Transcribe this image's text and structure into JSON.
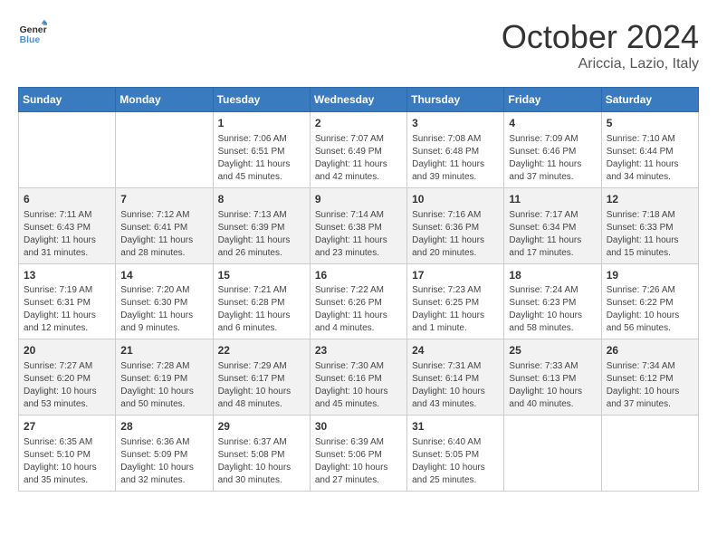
{
  "header": {
    "logo_line1": "General",
    "logo_line2": "Blue",
    "month": "October 2024",
    "location": "Ariccia, Lazio, Italy"
  },
  "days_of_week": [
    "Sunday",
    "Monday",
    "Tuesday",
    "Wednesday",
    "Thursday",
    "Friday",
    "Saturday"
  ],
  "weeks": [
    [
      {
        "day": null,
        "info": null
      },
      {
        "day": null,
        "info": null
      },
      {
        "day": "1",
        "sunrise": "Sunrise: 7:06 AM",
        "sunset": "Sunset: 6:51 PM",
        "daylight": "Daylight: 11 hours and 45 minutes."
      },
      {
        "day": "2",
        "sunrise": "Sunrise: 7:07 AM",
        "sunset": "Sunset: 6:49 PM",
        "daylight": "Daylight: 11 hours and 42 minutes."
      },
      {
        "day": "3",
        "sunrise": "Sunrise: 7:08 AM",
        "sunset": "Sunset: 6:48 PM",
        "daylight": "Daylight: 11 hours and 39 minutes."
      },
      {
        "day": "4",
        "sunrise": "Sunrise: 7:09 AM",
        "sunset": "Sunset: 6:46 PM",
        "daylight": "Daylight: 11 hours and 37 minutes."
      },
      {
        "day": "5",
        "sunrise": "Sunrise: 7:10 AM",
        "sunset": "Sunset: 6:44 PM",
        "daylight": "Daylight: 11 hours and 34 minutes."
      }
    ],
    [
      {
        "day": "6",
        "sunrise": "Sunrise: 7:11 AM",
        "sunset": "Sunset: 6:43 PM",
        "daylight": "Daylight: 11 hours and 31 minutes."
      },
      {
        "day": "7",
        "sunrise": "Sunrise: 7:12 AM",
        "sunset": "Sunset: 6:41 PM",
        "daylight": "Daylight: 11 hours and 28 minutes."
      },
      {
        "day": "8",
        "sunrise": "Sunrise: 7:13 AM",
        "sunset": "Sunset: 6:39 PM",
        "daylight": "Daylight: 11 hours and 26 minutes."
      },
      {
        "day": "9",
        "sunrise": "Sunrise: 7:14 AM",
        "sunset": "Sunset: 6:38 PM",
        "daylight": "Daylight: 11 hours and 23 minutes."
      },
      {
        "day": "10",
        "sunrise": "Sunrise: 7:16 AM",
        "sunset": "Sunset: 6:36 PM",
        "daylight": "Daylight: 11 hours and 20 minutes."
      },
      {
        "day": "11",
        "sunrise": "Sunrise: 7:17 AM",
        "sunset": "Sunset: 6:34 PM",
        "daylight": "Daylight: 11 hours and 17 minutes."
      },
      {
        "day": "12",
        "sunrise": "Sunrise: 7:18 AM",
        "sunset": "Sunset: 6:33 PM",
        "daylight": "Daylight: 11 hours and 15 minutes."
      }
    ],
    [
      {
        "day": "13",
        "sunrise": "Sunrise: 7:19 AM",
        "sunset": "Sunset: 6:31 PM",
        "daylight": "Daylight: 11 hours and 12 minutes."
      },
      {
        "day": "14",
        "sunrise": "Sunrise: 7:20 AM",
        "sunset": "Sunset: 6:30 PM",
        "daylight": "Daylight: 11 hours and 9 minutes."
      },
      {
        "day": "15",
        "sunrise": "Sunrise: 7:21 AM",
        "sunset": "Sunset: 6:28 PM",
        "daylight": "Daylight: 11 hours and 6 minutes."
      },
      {
        "day": "16",
        "sunrise": "Sunrise: 7:22 AM",
        "sunset": "Sunset: 6:26 PM",
        "daylight": "Daylight: 11 hours and 4 minutes."
      },
      {
        "day": "17",
        "sunrise": "Sunrise: 7:23 AM",
        "sunset": "Sunset: 6:25 PM",
        "daylight": "Daylight: 11 hours and 1 minute."
      },
      {
        "day": "18",
        "sunrise": "Sunrise: 7:24 AM",
        "sunset": "Sunset: 6:23 PM",
        "daylight": "Daylight: 10 hours and 58 minutes."
      },
      {
        "day": "19",
        "sunrise": "Sunrise: 7:26 AM",
        "sunset": "Sunset: 6:22 PM",
        "daylight": "Daylight: 10 hours and 56 minutes."
      }
    ],
    [
      {
        "day": "20",
        "sunrise": "Sunrise: 7:27 AM",
        "sunset": "Sunset: 6:20 PM",
        "daylight": "Daylight: 10 hours and 53 minutes."
      },
      {
        "day": "21",
        "sunrise": "Sunrise: 7:28 AM",
        "sunset": "Sunset: 6:19 PM",
        "daylight": "Daylight: 10 hours and 50 minutes."
      },
      {
        "day": "22",
        "sunrise": "Sunrise: 7:29 AM",
        "sunset": "Sunset: 6:17 PM",
        "daylight": "Daylight: 10 hours and 48 minutes."
      },
      {
        "day": "23",
        "sunrise": "Sunrise: 7:30 AM",
        "sunset": "Sunset: 6:16 PM",
        "daylight": "Daylight: 10 hours and 45 minutes."
      },
      {
        "day": "24",
        "sunrise": "Sunrise: 7:31 AM",
        "sunset": "Sunset: 6:14 PM",
        "daylight": "Daylight: 10 hours and 43 minutes."
      },
      {
        "day": "25",
        "sunrise": "Sunrise: 7:33 AM",
        "sunset": "Sunset: 6:13 PM",
        "daylight": "Daylight: 10 hours and 40 minutes."
      },
      {
        "day": "26",
        "sunrise": "Sunrise: 7:34 AM",
        "sunset": "Sunset: 6:12 PM",
        "daylight": "Daylight: 10 hours and 37 minutes."
      }
    ],
    [
      {
        "day": "27",
        "sunrise": "Sunrise: 6:35 AM",
        "sunset": "Sunset: 5:10 PM",
        "daylight": "Daylight: 10 hours and 35 minutes."
      },
      {
        "day": "28",
        "sunrise": "Sunrise: 6:36 AM",
        "sunset": "Sunset: 5:09 PM",
        "daylight": "Daylight: 10 hours and 32 minutes."
      },
      {
        "day": "29",
        "sunrise": "Sunrise: 6:37 AM",
        "sunset": "Sunset: 5:08 PM",
        "daylight": "Daylight: 10 hours and 30 minutes."
      },
      {
        "day": "30",
        "sunrise": "Sunrise: 6:39 AM",
        "sunset": "Sunset: 5:06 PM",
        "daylight": "Daylight: 10 hours and 27 minutes."
      },
      {
        "day": "31",
        "sunrise": "Sunrise: 6:40 AM",
        "sunset": "Sunset: 5:05 PM",
        "daylight": "Daylight: 10 hours and 25 minutes."
      },
      {
        "day": null,
        "info": null
      },
      {
        "day": null,
        "info": null
      }
    ]
  ]
}
